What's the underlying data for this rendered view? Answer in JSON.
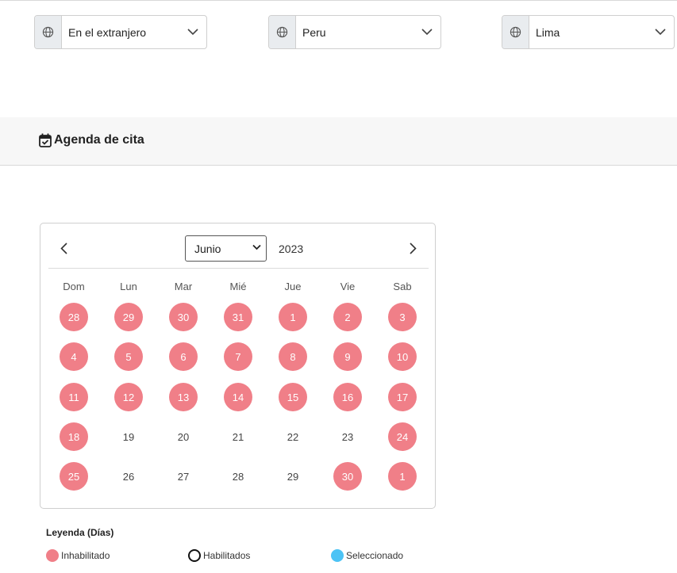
{
  "location": {
    "country_scope": "En el extranjero",
    "country": "Peru",
    "city": "Lima"
  },
  "section": {
    "title": "Agenda de cita"
  },
  "calendar": {
    "month": "Junio",
    "year": "2023",
    "weekdays": [
      "Dom",
      "Lun",
      "Mar",
      "Mié",
      "Jue",
      "Vie",
      "Sab"
    ],
    "weeks": [
      [
        {
          "d": "28",
          "s": "disabled"
        },
        {
          "d": "29",
          "s": "disabled"
        },
        {
          "d": "30",
          "s": "disabled"
        },
        {
          "d": "31",
          "s": "disabled"
        },
        {
          "d": "1",
          "s": "disabled"
        },
        {
          "d": "2",
          "s": "disabled"
        },
        {
          "d": "3",
          "s": "disabled"
        }
      ],
      [
        {
          "d": "4",
          "s": "disabled"
        },
        {
          "d": "5",
          "s": "disabled"
        },
        {
          "d": "6",
          "s": "disabled"
        },
        {
          "d": "7",
          "s": "disabled"
        },
        {
          "d": "8",
          "s": "disabled"
        },
        {
          "d": "9",
          "s": "disabled"
        },
        {
          "d": "10",
          "s": "disabled"
        }
      ],
      [
        {
          "d": "11",
          "s": "disabled"
        },
        {
          "d": "12",
          "s": "disabled"
        },
        {
          "d": "13",
          "s": "disabled"
        },
        {
          "d": "14",
          "s": "disabled"
        },
        {
          "d": "15",
          "s": "disabled"
        },
        {
          "d": "16",
          "s": "disabled"
        },
        {
          "d": "17",
          "s": "disabled"
        }
      ],
      [
        {
          "d": "18",
          "s": "disabled"
        },
        {
          "d": "19",
          "s": "enabled"
        },
        {
          "d": "20",
          "s": "enabled"
        },
        {
          "d": "21",
          "s": "enabled"
        },
        {
          "d": "22",
          "s": "enabled"
        },
        {
          "d": "23",
          "s": "enabled"
        },
        {
          "d": "24",
          "s": "disabled"
        }
      ],
      [
        {
          "d": "25",
          "s": "disabled"
        },
        {
          "d": "26",
          "s": "enabled"
        },
        {
          "d": "27",
          "s": "enabled"
        },
        {
          "d": "28",
          "s": "enabled"
        },
        {
          "d": "29",
          "s": "enabled"
        },
        {
          "d": "30",
          "s": "disabled"
        },
        {
          "d": "1",
          "s": "disabled"
        }
      ]
    ]
  },
  "legend": {
    "title": "Leyenda (Días)",
    "disabled_label": "Inhabilitado",
    "enabled_label": "Habilitados",
    "selected_label": "Seleccionado"
  },
  "colors": {
    "disabled": "#f07f88",
    "selected": "#4cc3f5",
    "enabled_border": "#111111"
  },
  "icons": {
    "select_prefix": "globe-icon",
    "select_suffix": "chevron-down-icon",
    "section": "calendar-check-icon",
    "prev": "chevron-left-icon",
    "next": "chevron-right-icon"
  }
}
